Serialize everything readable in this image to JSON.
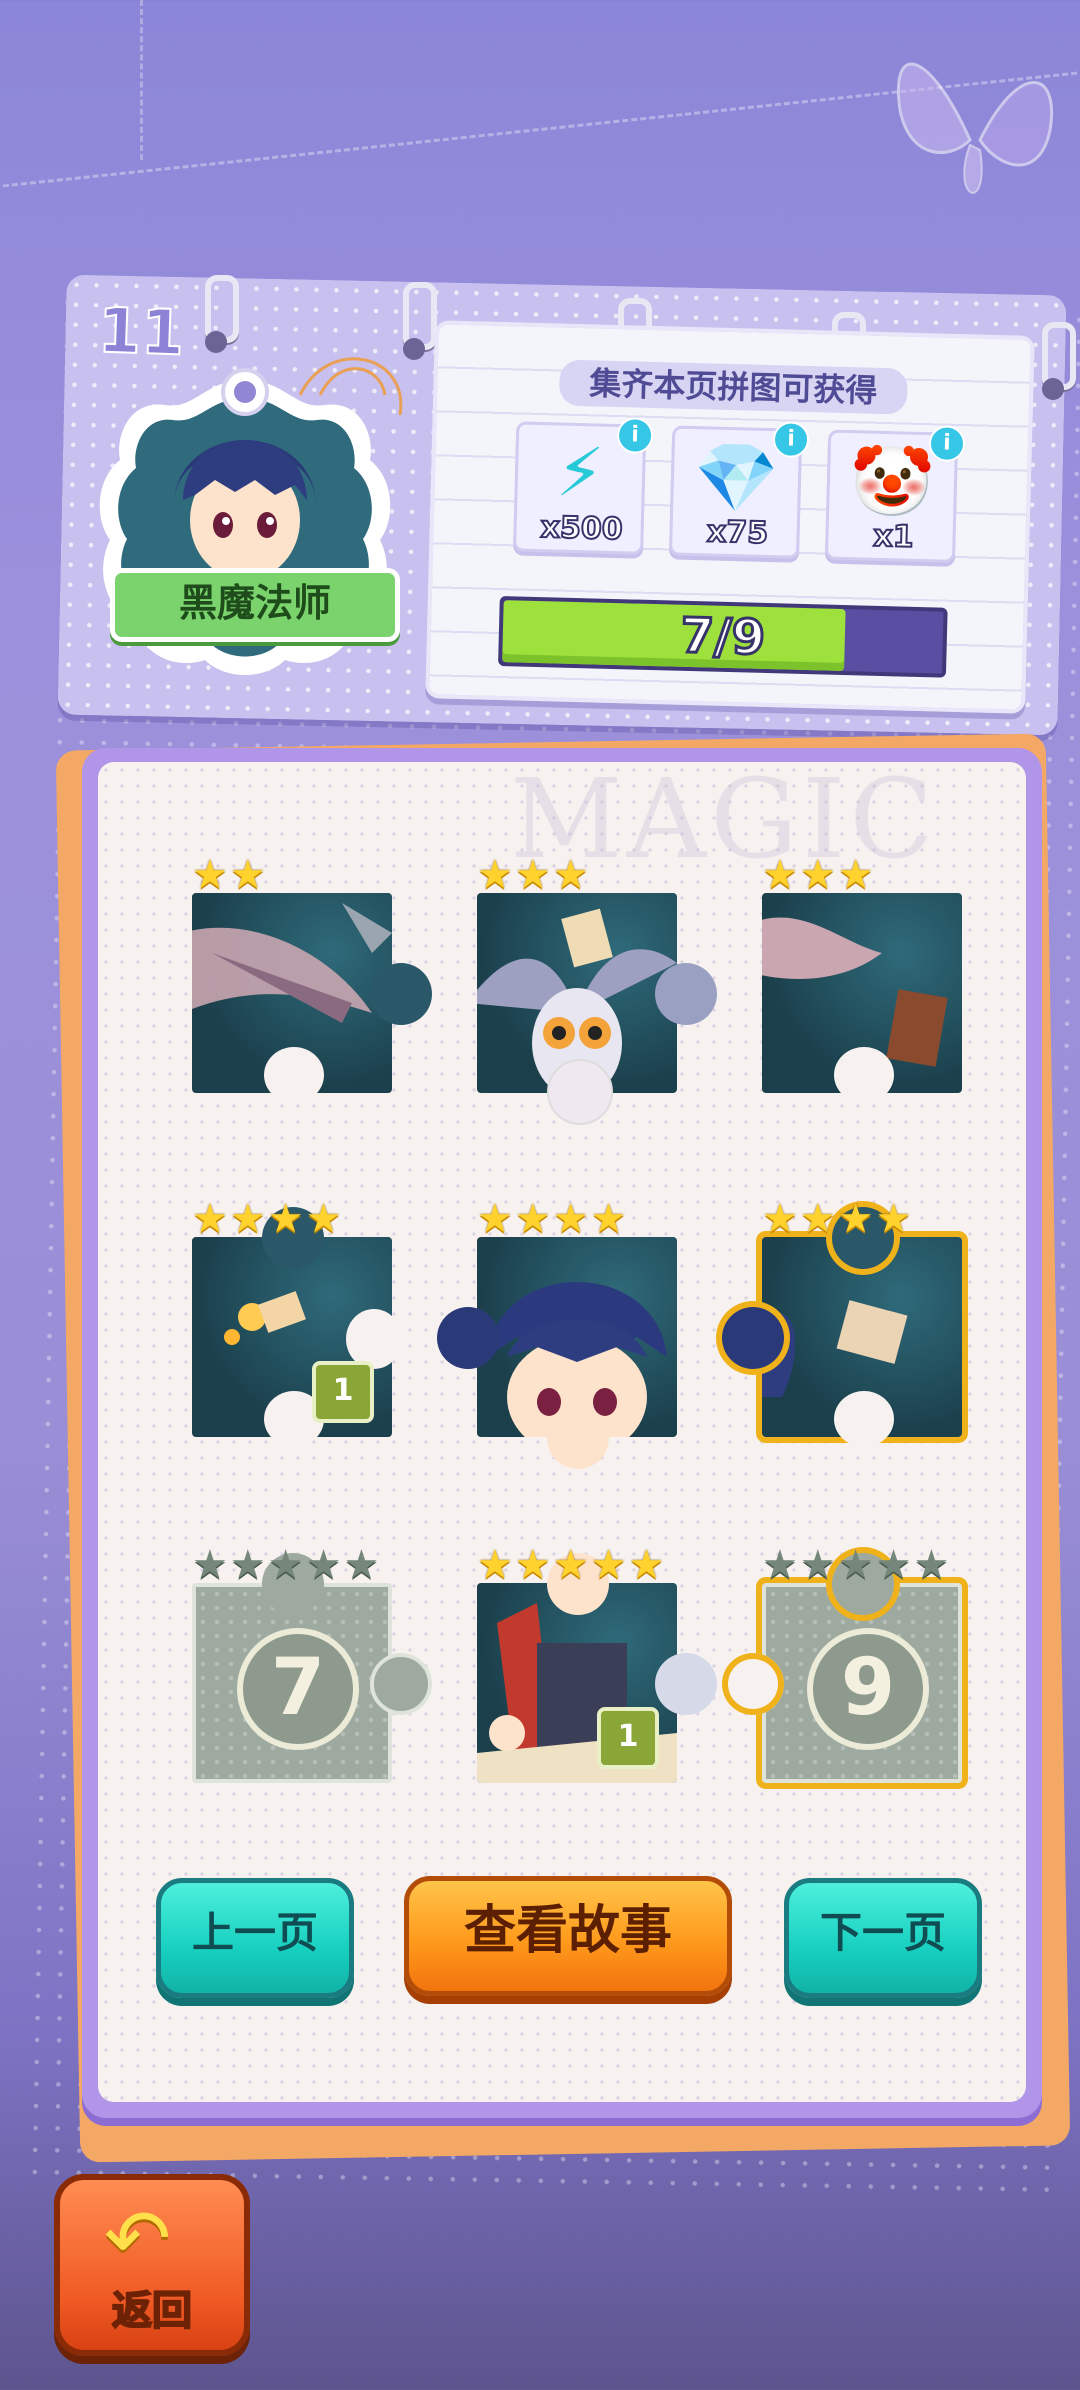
{
  "album": {
    "page_number": "11",
    "character_name": "黑魔法师",
    "watermark": "MAGIC"
  },
  "rewards": {
    "title": "集齐本页拼图可获得",
    "items": [
      {
        "icon": "lightning-energy-icon",
        "count": "x500"
      },
      {
        "icon": "blue-diamond-icon",
        "count": "x75"
      },
      {
        "icon": "jester-character-icon",
        "count": "x1"
      }
    ],
    "progress_text": "7/9",
    "progress_value": 0.778
  },
  "pieces": [
    {
      "stars_gold": 2,
      "stars_gray": 0,
      "state": "collected",
      "badge": ""
    },
    {
      "stars_gold": 3,
      "stars_gray": 0,
      "state": "collected",
      "badge": ""
    },
    {
      "stars_gold": 3,
      "stars_gray": 0,
      "state": "collected",
      "badge": ""
    },
    {
      "stars_gold": 4,
      "stars_gray": 0,
      "state": "collected",
      "badge": "1"
    },
    {
      "stars_gold": 4,
      "stars_gray": 0,
      "state": "collected",
      "badge": ""
    },
    {
      "stars_gold": 4,
      "stars_gray": 0,
      "state": "selected",
      "badge": ""
    },
    {
      "stars_gold": 0,
      "stars_gray": 5,
      "state": "locked",
      "number": "7"
    },
    {
      "stars_gold": 5,
      "stars_gray": 0,
      "state": "collected",
      "badge": "1"
    },
    {
      "stars_gold": 0,
      "stars_gray": 5,
      "state": "locked-selected",
      "number": "9"
    }
  ],
  "buttons": {
    "prev": "上一页",
    "story": "查看故事",
    "next": "下一页",
    "back": "返回"
  },
  "colors": {
    "accent_teal": "#17d0c0",
    "accent_orange": "#ff9a1c",
    "star_gold": "#ffd22e",
    "progress_green": "#9ee03c"
  }
}
